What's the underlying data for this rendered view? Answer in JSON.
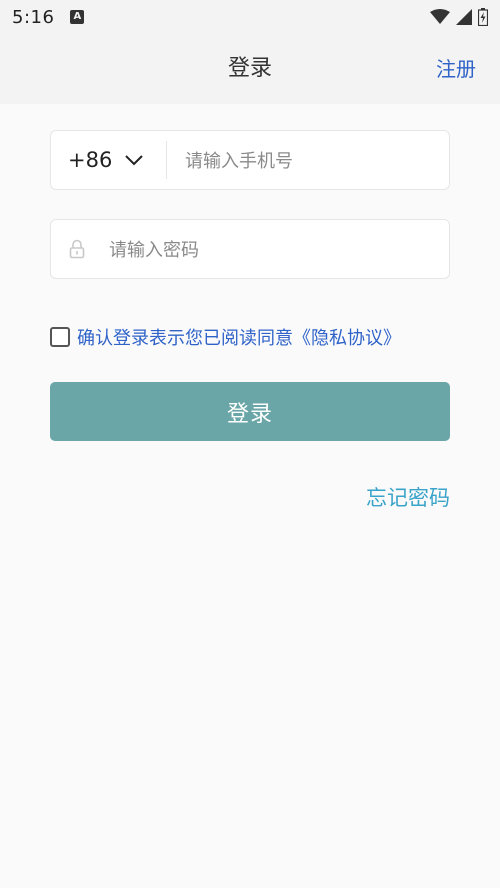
{
  "status_bar": {
    "time": "5:16",
    "notification_icon_label": "A",
    "icons": [
      "wifi-icon",
      "signal-icon",
      "battery-icon"
    ]
  },
  "nav": {
    "title": "登录",
    "register_label": "注册"
  },
  "phone_field": {
    "country_code": "+86",
    "value": "",
    "placeholder": "请输入手机号"
  },
  "password_field": {
    "value": "",
    "placeholder": "请输入密码"
  },
  "agreement": {
    "checked": false,
    "text": "确认登录表示您已阅读同意《隐私协议》"
  },
  "login_button_label": "登录",
  "forgot_password_label": "忘记密码",
  "colors": {
    "accent_blue": "#2f63c8",
    "button_teal": "#6aa6a7",
    "link_cyan": "#3aa3c9"
  }
}
